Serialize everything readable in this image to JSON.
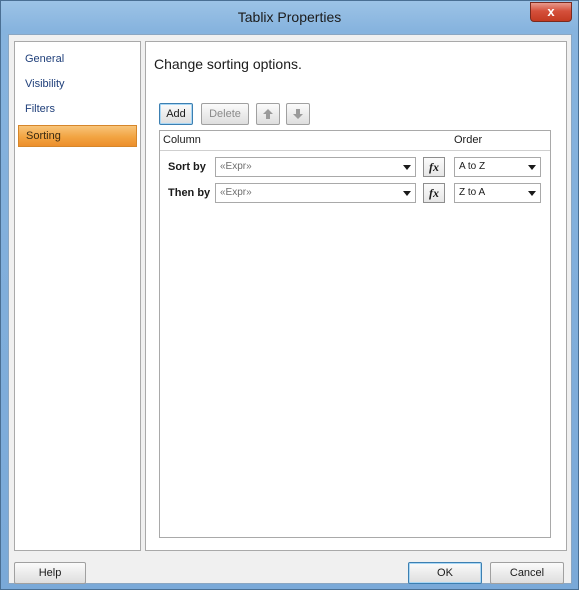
{
  "window": {
    "title": "Tablix Properties",
    "close_symbol": "x"
  },
  "nav": {
    "items": [
      {
        "label": "General"
      },
      {
        "label": "Visibility"
      },
      {
        "label": "Filters"
      },
      {
        "label": "Sorting",
        "selected": true
      }
    ]
  },
  "panel": {
    "heading": "Change sorting options.",
    "toolbar": {
      "add": "Add",
      "delete": "Delete",
      "move_up_icon": "arrow-up-icon",
      "move_down_icon": "arrow-down-icon"
    },
    "grid": {
      "columns": [
        "Column",
        "Order"
      ],
      "rows": [
        {
          "label": "Sort by",
          "column": "«Expr»",
          "fx": "fx",
          "order": "A to Z"
        },
        {
          "label": "Then by",
          "column": "«Expr»",
          "fx": "fx",
          "order": "Z to A"
        }
      ]
    }
  },
  "footer": {
    "help": "Help",
    "ok": "OK",
    "cancel": "Cancel"
  },
  "colors": {
    "selected_nav": "#f2a442",
    "titlebar": "#86b3de",
    "close_button": "#d5503b"
  }
}
